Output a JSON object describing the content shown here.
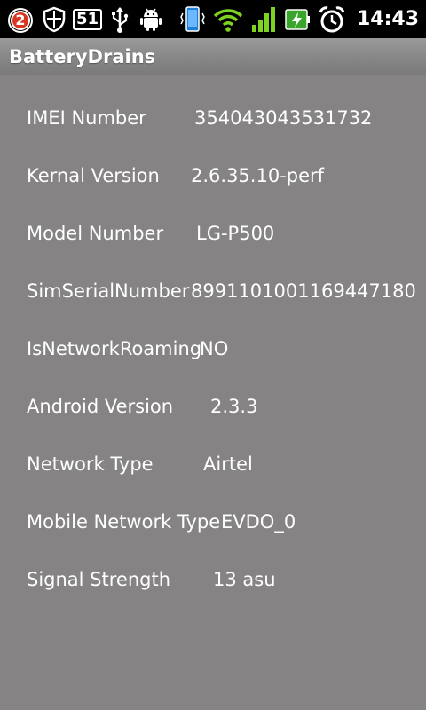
{
  "status_bar": {
    "notification_count": "2",
    "badge_number": "51",
    "time": "14:43",
    "colors": {
      "badge_red": "#d9351f",
      "signal_green": "#7ed321",
      "battery_green": "#3aa52b"
    },
    "icons": [
      "notification-badge-icon",
      "shield-icon",
      "number-badge-icon",
      "usb-icon",
      "android-debug-icon",
      "phone-vibrate-icon",
      "wifi-icon",
      "signal-strength-icon",
      "battery-charging-icon",
      "alarm-clock-icon"
    ]
  },
  "app": {
    "title": "BatteryDrains"
  },
  "info": {
    "rows": [
      {
        "label": "IMEI Number",
        "value": "354043043531732"
      },
      {
        "label": "Kernal Version",
        "value": "2.6.35.10-perf"
      },
      {
        "label": "Model Number",
        "value": "LG-P500"
      },
      {
        "label": "SimSerialNumber",
        "value": "8991101001169447180"
      },
      {
        "label": "IsNetworkRoaming",
        "value": "NO"
      },
      {
        "label": "Android Version",
        "value": "2.3.3"
      },
      {
        "label": "Network Type",
        "value": "Airtel"
      },
      {
        "label": "Mobile Network Type",
        "value": "EVDO_0"
      },
      {
        "label": "Signal Strength",
        "value": "13 asu"
      }
    ]
  }
}
